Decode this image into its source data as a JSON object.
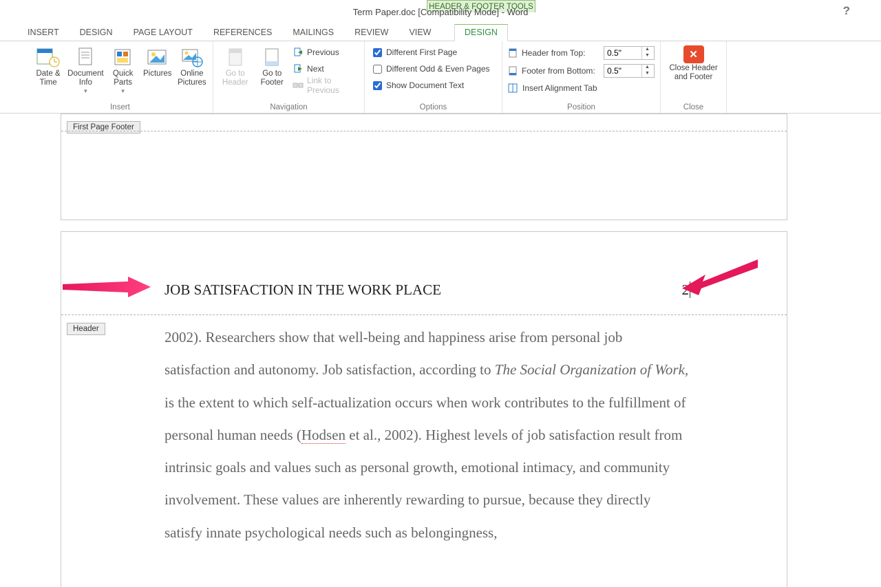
{
  "title": "Term Paper.doc [Compatibility Mode] - Word",
  "context_tool_label": "HEADER & FOOTER TOOLS",
  "tabs": {
    "insert": "INSERT",
    "design_std": "DESIGN",
    "page_layout": "PAGE LAYOUT",
    "references": "REFERENCES",
    "mailings": "MAILINGS",
    "review": "REVIEW",
    "view": "VIEW",
    "design_ctx": "DESIGN"
  },
  "ribbon": {
    "insert_group": {
      "label": "Insert",
      "date_time": "Date & Time",
      "doc_info": "Document Info",
      "quick_parts": "Quick Parts",
      "pictures": "Pictures",
      "online_pictures": "Online Pictures"
    },
    "navigation_group": {
      "label": "Navigation",
      "goto_header": "Go to Header",
      "goto_footer": "Go to Footer",
      "previous": "Previous",
      "next": "Next",
      "link_prev": "Link to Previous"
    },
    "options_group": {
      "label": "Options",
      "diff_first": "Different First Page",
      "diff_odd_even": "Different Odd & Even Pages",
      "show_doc_text": "Show Document Text"
    },
    "position_group": {
      "label": "Position",
      "header_from_top": "Header from Top:",
      "footer_from_bottom": "Footer from Bottom:",
      "insert_align_tab": "Insert Alignment Tab",
      "header_val": "0.5\"",
      "footer_val": "0.5\""
    },
    "close_group": {
      "label": "Close",
      "close_hf": "Close Header and Footer"
    }
  },
  "doc": {
    "tag_first_footer": "First Page Footer",
    "tag_header": "Header",
    "running_head": "JOB SATISFACTION IN THE WORK PLACE",
    "page_number": "2",
    "body_pre": "2002). Researchers show that well-being and happiness arise from personal job satisfaction and autonomy. Job satisfaction, according to ",
    "body_ital": "The Social Organization of Work,",
    "body_mid": " is the extent to which self-actualization occurs when work contributes to the fulfillment of personal human needs (",
    "body_err": "Hodsen",
    "body_post": " et al., 2002). Highest levels of job satisfaction result from intrinsic goals and values such as personal growth, emotional intimacy, and community involvement. These values are inherently rewarding to pursue, because they directly satisfy innate psychological needs such as belongingness,"
  }
}
